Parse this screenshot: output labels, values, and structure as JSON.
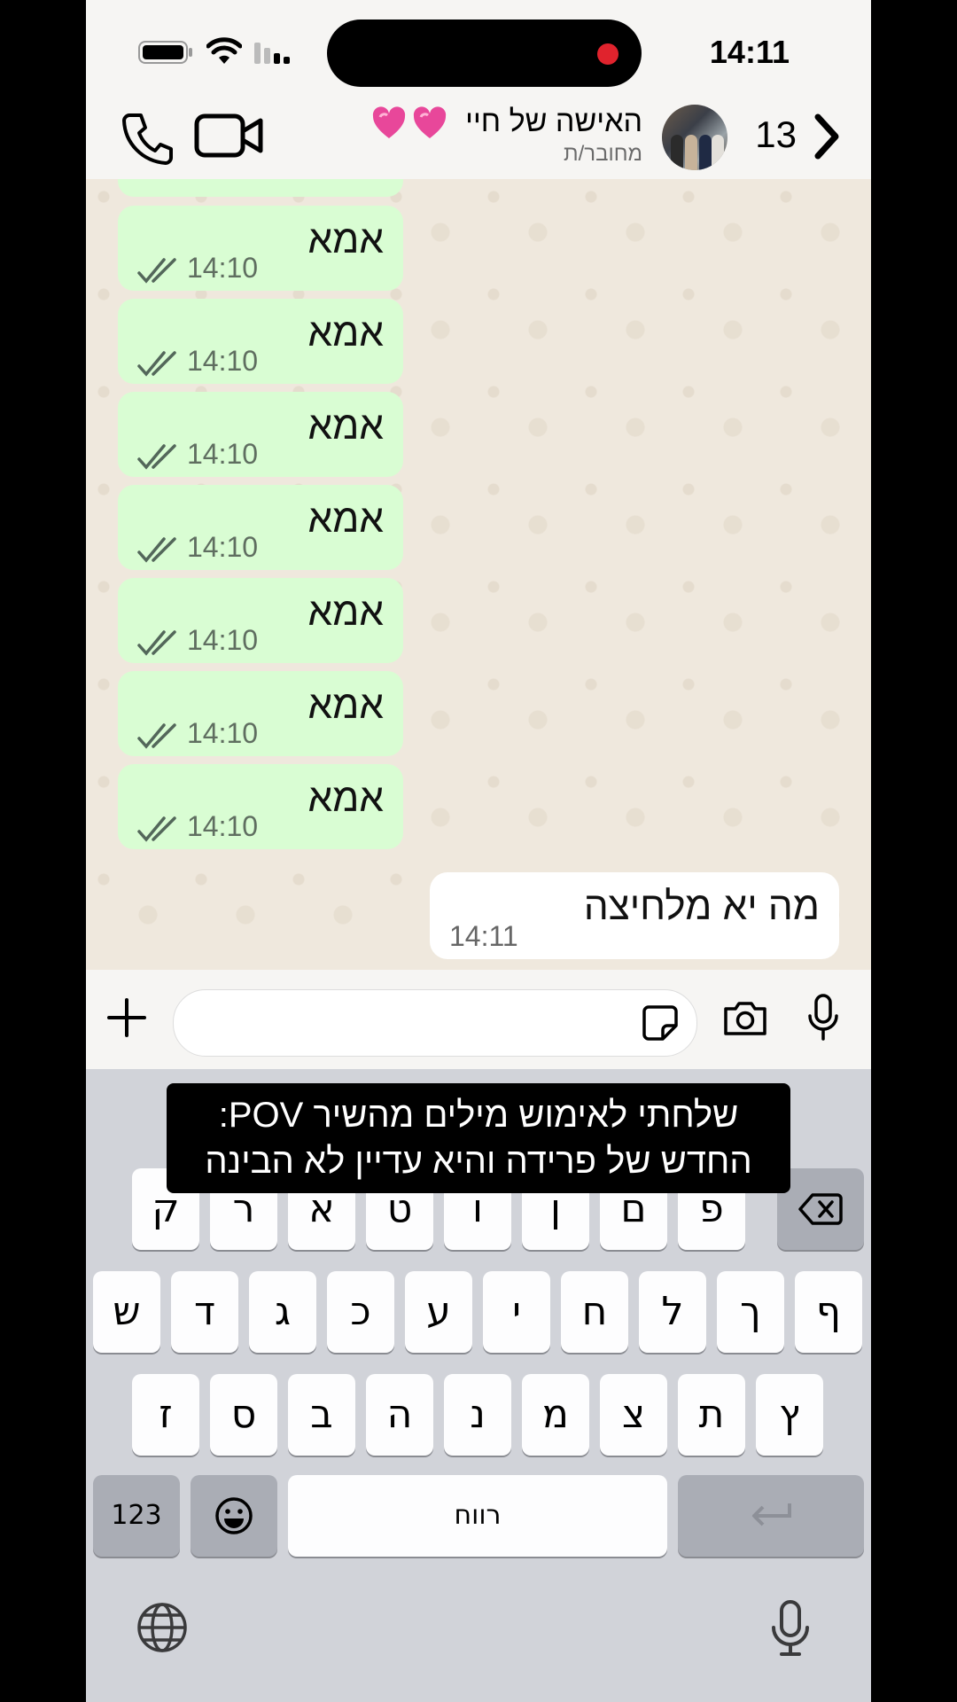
{
  "status_bar": {
    "time": "14:11"
  },
  "header": {
    "unread_count": "13",
    "contact_name": "האישה של חיי",
    "contact_emoji": "💗💗",
    "contact_status": "מחובר/ת"
  },
  "messages": [
    {
      "direction": "out",
      "text": "אמא",
      "time": "14:10"
    },
    {
      "direction": "out",
      "text": "אמא",
      "time": "14:10"
    },
    {
      "direction": "out",
      "text": "אמא",
      "time": "14:10"
    },
    {
      "direction": "out",
      "text": "אמא",
      "time": "14:10"
    },
    {
      "direction": "out",
      "text": "אמא",
      "time": "14:10"
    },
    {
      "direction": "out",
      "text": "אמא",
      "time": "14:10"
    },
    {
      "direction": "out",
      "text": "אמא",
      "time": "14:10"
    },
    {
      "direction": "in",
      "text": "מה יא מלחיצה",
      "time": "14:11"
    }
  ],
  "input": {
    "placeholder": ""
  },
  "caption": {
    "line1": "שלחתי לאימוש מילים מהשיר POV:",
    "line2": "החדש של פרידה והיא עדיין לא הבינה"
  },
  "keyboard": {
    "row1": [
      "פ",
      "ם",
      "ן",
      "ו",
      "ט",
      "א",
      "ר",
      "ק"
    ],
    "row2": [
      "ף",
      "ך",
      "ל",
      "ח",
      "י",
      "ע",
      "כ",
      "ג",
      "ד",
      "ש"
    ],
    "row3": [
      "ץ",
      "ת",
      "צ",
      "מ",
      "נ",
      "ה",
      "ב",
      "ס",
      "ז"
    ],
    "numbers_label": "123",
    "space_label": "רווח",
    "icons": {
      "backspace": "backspace-icon",
      "emoji": "emoji-icon",
      "return": "return-icon",
      "globe": "globe-icon",
      "dictation": "microphone-icon"
    }
  },
  "colors": {
    "outgoing_bubble": "#d9fdd3",
    "incoming_bubble": "#ffffff",
    "recording_dot": "#e0232d",
    "heart": "#e8479a"
  }
}
